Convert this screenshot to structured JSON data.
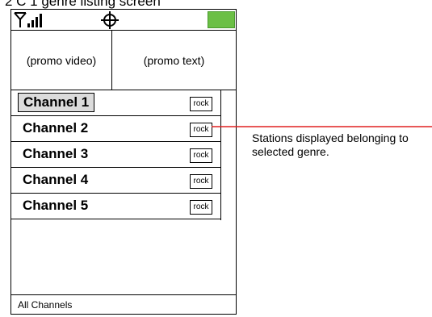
{
  "heading": "2 C 1 genre listing screen",
  "status_bar": {
    "signal_icon": "signal-bars-icon",
    "center_icon": "crosshair-icon",
    "battery_icon": "battery-icon",
    "battery_color": "#6bbf45"
  },
  "promo": {
    "video_label": "(promo video)",
    "text_label": "(promo text)"
  },
  "channels": [
    {
      "name": "Channel 1",
      "genre": "rock",
      "selected": true
    },
    {
      "name": "Channel 2",
      "genre": "rock",
      "selected": false
    },
    {
      "name": "Channel 3",
      "genre": "rock",
      "selected": false
    },
    {
      "name": "Channel 4",
      "genre": "rock",
      "selected": false
    },
    {
      "name": "Channel 5",
      "genre": "rock",
      "selected": false
    }
  ],
  "footer": {
    "label": "All Channels"
  },
  "annotation": {
    "text": "Stations displayed belonging to selected genre.",
    "line_color": "#e02020"
  }
}
